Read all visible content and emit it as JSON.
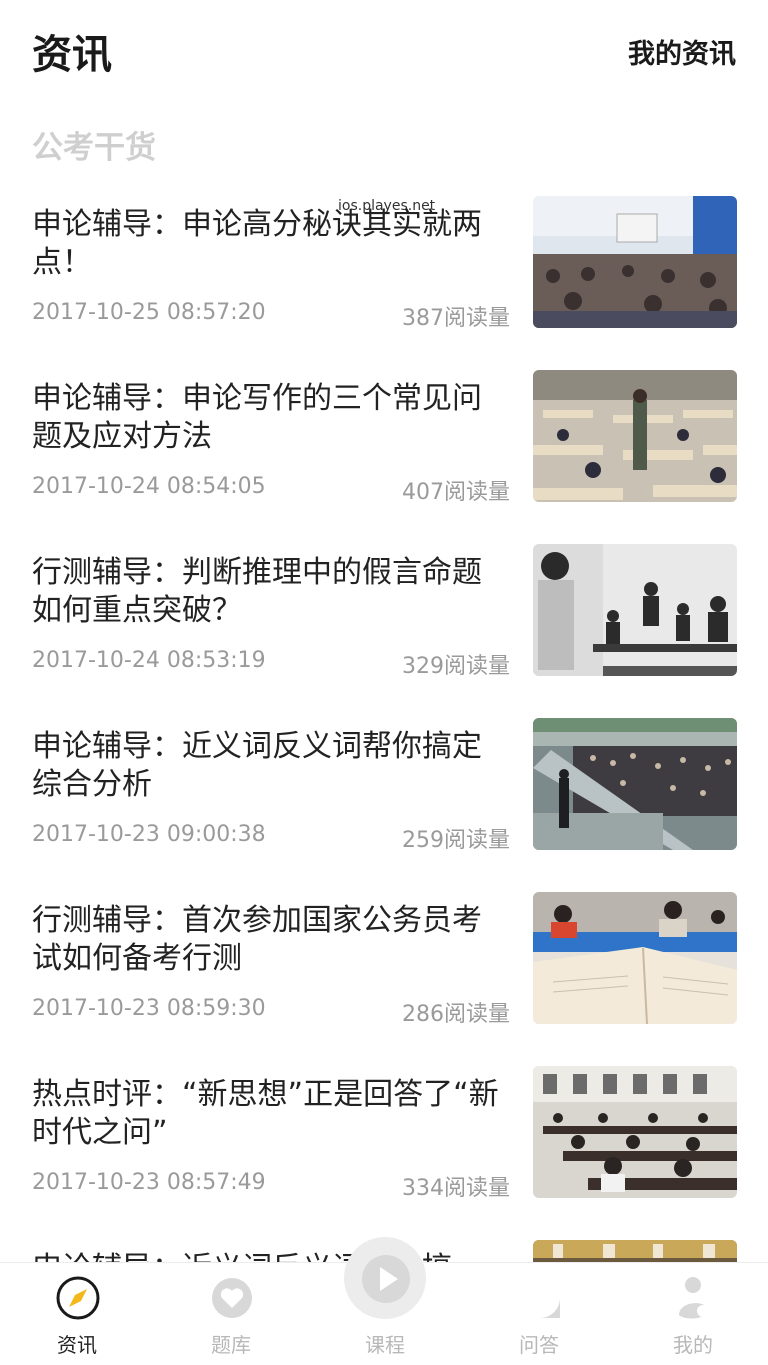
{
  "header": {
    "title": "资讯",
    "right_link": "我的资讯"
  },
  "watermark": "ios.playes.net",
  "section": {
    "title": "公考干货"
  },
  "articles": [
    {
      "title": "申论辅导：申论高分秘诀其实就两点！",
      "time": "2017-10-25 08:57:20",
      "reads": "387阅读量",
      "thumb": "classroom-exam-photo"
    },
    {
      "title": "申论辅导：申论写作的三个常见问题及应对方法",
      "time": "2017-10-24 08:54:05",
      "reads": "407阅读量",
      "thumb": "exam-hall-photo"
    },
    {
      "title": "行测辅导：判断推理中的假言命题如何重点突破？",
      "time": "2017-10-24 08:53:19",
      "reads": "329阅读量",
      "thumb": "interview-photo"
    },
    {
      "title": "申论辅导：近义词反义词帮你搞定综合分析",
      "time": "2017-10-23 09:00:38",
      "reads": "259阅读量",
      "thumb": "crowd-gate-photo"
    },
    {
      "title": "行测辅导：首次参加国家公务员考试如何备考行测",
      "time": "2017-10-23 08:59:30",
      "reads": "286阅读量",
      "thumb": "exam-paper-photo"
    },
    {
      "title": "热点时评：“新思想”正是回答了“新时代之问”",
      "time": "2017-10-23 08:57:49",
      "reads": "334阅读量",
      "thumb": "exam-room-photo"
    },
    {
      "title": "申论辅导：近义词反义词帮你搞",
      "time": "",
      "reads": "",
      "thumb": "classroom-photo"
    }
  ],
  "tabbar": {
    "items": [
      {
        "label": "资讯",
        "icon": "compass-icon",
        "active": true
      },
      {
        "label": "题库",
        "icon": "heart-icon",
        "active": false
      },
      {
        "label": "课程",
        "icon": "play-icon",
        "active": false
      },
      {
        "label": "问答",
        "icon": "chat-bubble-icon",
        "active": false
      },
      {
        "label": "我的",
        "icon": "person-icon",
        "active": false
      }
    ]
  },
  "colors": {
    "text": "#222222",
    "muted": "#9a9a9a",
    "section": "#cfcfcf",
    "tab_inactive": "#b8b8b8",
    "compass_accent": "#f5b81c"
  }
}
